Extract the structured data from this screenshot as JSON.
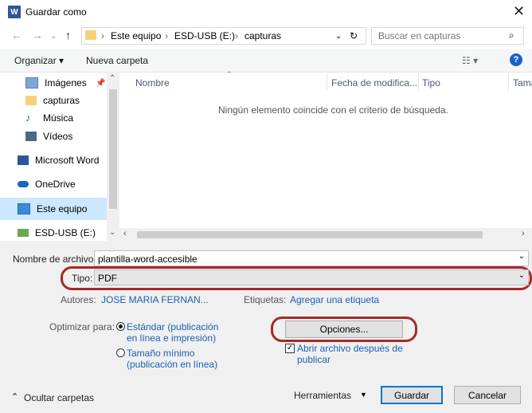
{
  "window": {
    "title": "Guardar como",
    "app_icon_letter": "W"
  },
  "navigation": {
    "breadcrumb": [
      "Este equipo",
      "ESD-USB (E:)",
      "capturas"
    ],
    "search_placeholder": "Buscar en capturas"
  },
  "toolbar": {
    "organize": "Organizar ▾",
    "new_folder": "Nueva carpeta"
  },
  "sidebar": {
    "items": [
      {
        "label": "Imágenes",
        "icon": "pictures-icon"
      },
      {
        "label": "capturas",
        "icon": "folder-icon"
      },
      {
        "label": "Música",
        "icon": "music-icon"
      },
      {
        "label": "Vídeos",
        "icon": "video-icon"
      },
      {
        "label": "Microsoft Word",
        "icon": "word-icon"
      },
      {
        "label": "OneDrive",
        "icon": "cloud-icon"
      },
      {
        "label": "Este equipo",
        "icon": "computer-icon",
        "selected": true
      },
      {
        "label": "ESD-USB (E:)",
        "icon": "usb-drive-icon"
      }
    ]
  },
  "file_list": {
    "columns": [
      "Nombre",
      "Fecha de modifica...",
      "Tipo",
      "Tama"
    ],
    "empty_message": "Ningún elemento coincide con el criterio de búsqueda."
  },
  "form": {
    "filename_label": "Nombre de archivo:",
    "filename_value": "plantilla-word-accesible",
    "type_label": "Tipo:",
    "type_value": "PDF",
    "authors_label": "Autores:",
    "authors_value": "JOSE MARIA FERNAN...",
    "tags_label": "Etiquetas:",
    "tags_value": "Agregar una etiqueta",
    "optimize_label": "Optimizar para:",
    "optimize_standard": [
      "Estándar (publicación",
      "en línea e impresión)"
    ],
    "optimize_minimum": [
      "Tamaño mínimo",
      "(publicación en línea)"
    ],
    "options_button": "Opciones...",
    "open_after": [
      "Abrir archivo después de",
      "publicar"
    ]
  },
  "footer": {
    "hide_folders": "Ocultar carpetas",
    "tools": "Herramientas",
    "save": "Guardar",
    "cancel": "Cancelar"
  },
  "colors": {
    "accent": "#0078d7",
    "highlight": "#a52a2a",
    "link": "#1a5fb4"
  }
}
